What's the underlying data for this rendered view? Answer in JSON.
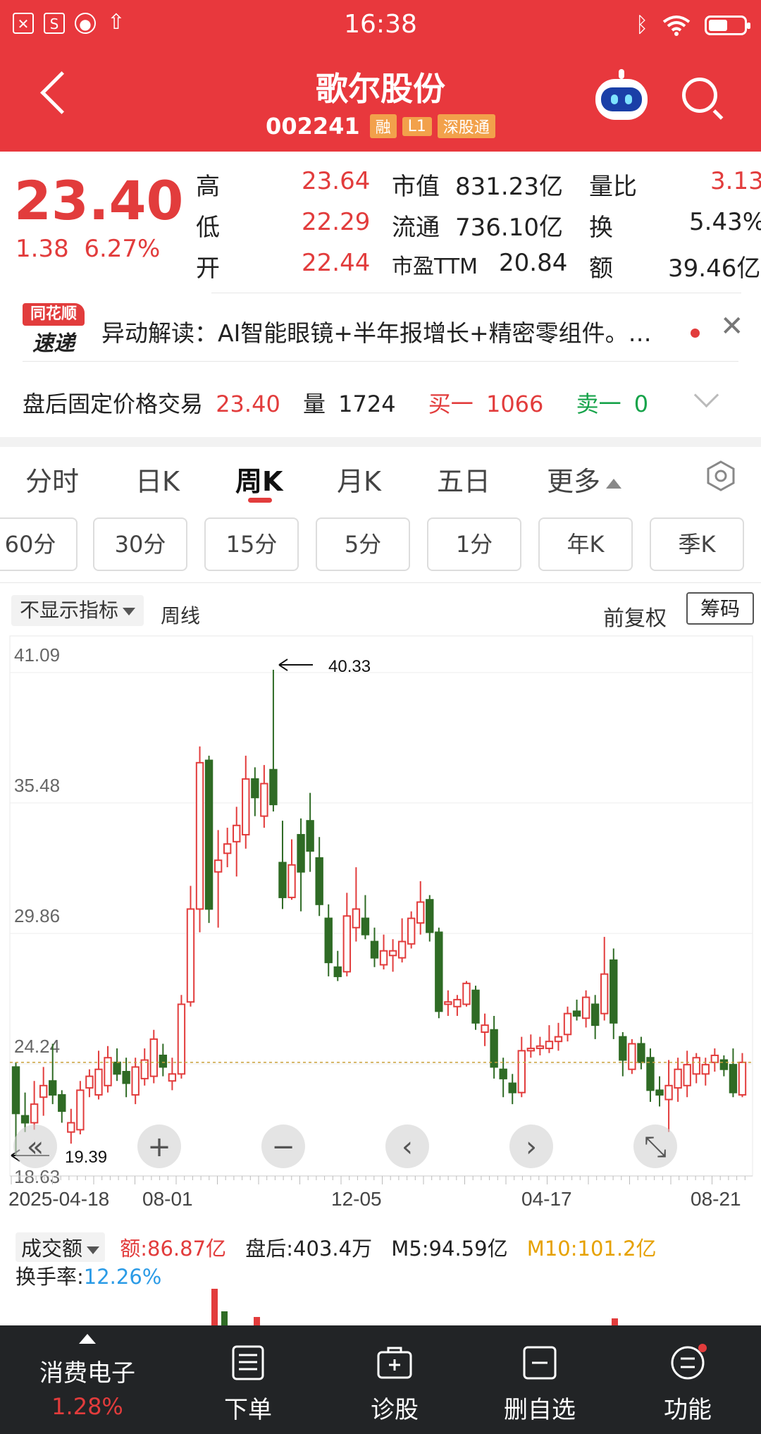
{
  "status": {
    "time": "16:38"
  },
  "header": {
    "title": "歌尔股份",
    "code": "002241",
    "tags": [
      "融",
      "L1",
      "深股通"
    ]
  },
  "quote": {
    "price": "23.40",
    "change": "1.38",
    "change_pct": "6.27%",
    "high_label": "高",
    "high": "23.64",
    "low_label": "低",
    "low": "22.29",
    "open_label": "开",
    "open": "22.44",
    "mcap_label": "市值",
    "mcap": "831.23亿",
    "float_label": "流通",
    "float": "736.10亿",
    "pe_label": "市盈TTM",
    "pe": "20.84",
    "vr_label": "量比",
    "vr": "3.13",
    "turnover_label": "换",
    "turnover": "5.43%",
    "amount_label": "额",
    "amount": "39.46亿"
  },
  "news": {
    "logo_top": "同花顺",
    "logo_bottom": "速递",
    "text": "异动解读：AI智能眼镜+半年报增长+精密零组件。…"
  },
  "after_hours": {
    "label": "盘后固定价格交易",
    "price": "23.40",
    "vol_label": "量",
    "vol": "1724",
    "buy1_label": "买一",
    "buy1": "1066",
    "sell1_label": "卖一",
    "sell1": "0"
  },
  "tabs": [
    "分时",
    "日K",
    "周K",
    "月K",
    "五日",
    "更多"
  ],
  "active_tab": "周K",
  "periods": [
    "60分",
    "30分",
    "15分",
    "5分",
    "1分",
    "年K",
    "季K"
  ],
  "chart_controls": {
    "indicator": "不显示指标",
    "period_label": "周线",
    "adjust": "前复权",
    "chips": "筹码"
  },
  "chart_data": {
    "type": "candlestick",
    "y_ticks": [
      "41.09",
      "35.48",
      "29.86",
      "24.24",
      "18.63"
    ],
    "ylim": [
      18.63,
      41.09
    ],
    "x_ticks": [
      "2025-04-18",
      "08-01",
      "12-05",
      "04-17",
      "08-21"
    ],
    "max_label": "40.33",
    "min_label": "19.39",
    "last_close": 23.4,
    "candles": [
      {
        "o": 23.2,
        "h": 23.4,
        "l": 19.4,
        "c": 21.2
      },
      {
        "o": 21.1,
        "h": 22.1,
        "l": 20.4,
        "c": 20.8
      },
      {
        "o": 20.8,
        "h": 22.6,
        "l": 20.5,
        "c": 21.6
      },
      {
        "o": 21.9,
        "h": 23.2,
        "l": 21.1,
        "c": 22.4
      },
      {
        "o": 22.6,
        "h": 24.2,
        "l": 21.6,
        "c": 22.0
      },
      {
        "o": 22.0,
        "h": 22.2,
        "l": 20.8,
        "c": 21.3
      },
      {
        "o": 20.4,
        "h": 21.4,
        "l": 19.9,
        "c": 20.8
      },
      {
        "o": 20.5,
        "h": 22.6,
        "l": 20.3,
        "c": 22.2
      },
      {
        "o": 22.3,
        "h": 23.1,
        "l": 21.9,
        "c": 22.8
      },
      {
        "o": 22.0,
        "h": 23.9,
        "l": 21.8,
        "c": 23.1
      },
      {
        "o": 22.4,
        "h": 24.1,
        "l": 22.1,
        "c": 23.6
      },
      {
        "o": 23.4,
        "h": 24.0,
        "l": 22.6,
        "c": 22.9
      },
      {
        "o": 23.0,
        "h": 23.6,
        "l": 21.9,
        "c": 22.5
      },
      {
        "o": 22.0,
        "h": 23.6,
        "l": 21.6,
        "c": 23.2
      },
      {
        "o": 22.7,
        "h": 24.0,
        "l": 22.4,
        "c": 23.5
      },
      {
        "o": 22.8,
        "h": 24.8,
        "l": 22.5,
        "c": 24.4
      },
      {
        "o": 23.7,
        "h": 24.2,
        "l": 22.8,
        "c": 23.2
      },
      {
        "o": 22.6,
        "h": 23.6,
        "l": 22.2,
        "c": 22.9
      },
      {
        "o": 22.9,
        "h": 26.3,
        "l": 22.7,
        "c": 25.9
      },
      {
        "o": 26.0,
        "h": 31.0,
        "l": 25.8,
        "c": 30.0
      },
      {
        "o": 30.0,
        "h": 37.0,
        "l": 29.0,
        "c": 36.3
      },
      {
        "o": 36.4,
        "h": 36.6,
        "l": 29.4,
        "c": 30.0
      },
      {
        "o": 31.6,
        "h": 33.4,
        "l": 29.2,
        "c": 32.1
      },
      {
        "o": 32.4,
        "h": 33.5,
        "l": 31.8,
        "c": 32.8
      },
      {
        "o": 32.9,
        "h": 34.4,
        "l": 31.4,
        "c": 33.6
      },
      {
        "o": 33.2,
        "h": 36.6,
        "l": 32.6,
        "c": 35.6
      },
      {
        "o": 35.6,
        "h": 36.1,
        "l": 34.0,
        "c": 34.8
      },
      {
        "o": 34.0,
        "h": 36.2,
        "l": 33.5,
        "c": 35.4
      },
      {
        "o": 36.0,
        "h": 40.3,
        "l": 34.2,
        "c": 34.5
      },
      {
        "o": 32.0,
        "h": 33.8,
        "l": 30.0,
        "c": 30.5
      },
      {
        "o": 30.5,
        "h": 33.0,
        "l": 30.4,
        "c": 31.9
      },
      {
        "o": 33.2,
        "h": 33.9,
        "l": 29.9,
        "c": 31.6
      },
      {
        "o": 33.8,
        "h": 35.0,
        "l": 31.6,
        "c": 32.5
      },
      {
        "o": 32.2,
        "h": 33.1,
        "l": 29.7,
        "c": 30.2
      },
      {
        "o": 29.6,
        "h": 30.2,
        "l": 27.1,
        "c": 27.7
      },
      {
        "o": 27.5,
        "h": 28.2,
        "l": 26.9,
        "c": 27.1
      },
      {
        "o": 27.3,
        "h": 30.7,
        "l": 27.1,
        "c": 29.7
      },
      {
        "o": 29.2,
        "h": 31.8,
        "l": 28.6,
        "c": 30.0
      },
      {
        "o": 29.6,
        "h": 30.6,
        "l": 28.7,
        "c": 28.9
      },
      {
        "o": 28.6,
        "h": 29.2,
        "l": 27.5,
        "c": 27.9
      },
      {
        "o": 27.6,
        "h": 28.9,
        "l": 27.4,
        "c": 28.2
      },
      {
        "o": 28.0,
        "h": 28.7,
        "l": 27.3,
        "c": 28.2
      },
      {
        "o": 27.9,
        "h": 29.6,
        "l": 27.7,
        "c": 28.6
      },
      {
        "o": 28.5,
        "h": 29.9,
        "l": 28.3,
        "c": 29.6
      },
      {
        "o": 29.4,
        "h": 31.2,
        "l": 28.9,
        "c": 30.3
      },
      {
        "o": 30.4,
        "h": 30.6,
        "l": 28.6,
        "c": 29.0
      },
      {
        "o": 29.0,
        "h": 29.2,
        "l": 25.3,
        "c": 25.6
      },
      {
        "o": 25.9,
        "h": 26.5,
        "l": 25.4,
        "c": 26.0
      },
      {
        "o": 25.8,
        "h": 26.3,
        "l": 25.4,
        "c": 26.1
      },
      {
        "o": 25.9,
        "h": 26.9,
        "l": 25.8,
        "c": 26.8
      },
      {
        "o": 26.5,
        "h": 26.7,
        "l": 24.8,
        "c": 25.1
      },
      {
        "o": 24.7,
        "h": 25.5,
        "l": 24.1,
        "c": 25.0
      },
      {
        "o": 24.8,
        "h": 25.4,
        "l": 22.7,
        "c": 23.2
      },
      {
        "o": 23.1,
        "h": 23.6,
        "l": 21.9,
        "c": 22.7
      },
      {
        "o": 22.5,
        "h": 22.9,
        "l": 21.6,
        "c": 22.1
      },
      {
        "o": 22.1,
        "h": 24.5,
        "l": 21.9,
        "c": 23.9
      },
      {
        "o": 23.9,
        "h": 24.6,
        "l": 23.6,
        "c": 24.0
      },
      {
        "o": 24.0,
        "h": 24.5,
        "l": 23.7,
        "c": 24.1
      },
      {
        "o": 24.0,
        "h": 25.0,
        "l": 23.8,
        "c": 24.3
      },
      {
        "o": 24.3,
        "h": 25.1,
        "l": 23.9,
        "c": 24.5
      },
      {
        "o": 24.6,
        "h": 25.8,
        "l": 24.3,
        "c": 25.5
      },
      {
        "o": 25.6,
        "h": 26.1,
        "l": 25.2,
        "c": 25.4
      },
      {
        "o": 25.3,
        "h": 26.5,
        "l": 24.9,
        "c": 26.2
      },
      {
        "o": 25.9,
        "h": 26.3,
        "l": 24.4,
        "c": 25.0
      },
      {
        "o": 25.5,
        "h": 28.8,
        "l": 25.2,
        "c": 27.2
      },
      {
        "o": 27.8,
        "h": 28.3,
        "l": 24.4,
        "c": 25.1
      },
      {
        "o": 24.5,
        "h": 24.7,
        "l": 22.8,
        "c": 23.5
      },
      {
        "o": 23.1,
        "h": 24.4,
        "l": 22.9,
        "c": 24.2
      },
      {
        "o": 24.2,
        "h": 24.5,
        "l": 23.1,
        "c": 23.4
      },
      {
        "o": 23.6,
        "h": 24.0,
        "l": 21.7,
        "c": 22.2
      },
      {
        "o": 22.2,
        "h": 22.8,
        "l": 21.5,
        "c": 22.0
      },
      {
        "o": 21.8,
        "h": 23.5,
        "l": 20.4,
        "c": 22.4
      },
      {
        "o": 22.3,
        "h": 23.6,
        "l": 21.7,
        "c": 23.1
      },
      {
        "o": 22.4,
        "h": 23.9,
        "l": 21.9,
        "c": 23.3
      },
      {
        "o": 22.9,
        "h": 23.8,
        "l": 22.5,
        "c": 23.6
      },
      {
        "o": 22.9,
        "h": 23.6,
        "l": 22.4,
        "c": 23.3
      },
      {
        "o": 23.4,
        "h": 24.0,
        "l": 23.0,
        "c": 23.7
      },
      {
        "o": 23.5,
        "h": 23.7,
        "l": 22.8,
        "c": 23.1
      },
      {
        "o": 23.3,
        "h": 24.0,
        "l": 21.9,
        "c": 22.1
      },
      {
        "o": 22.0,
        "h": 23.8,
        "l": 21.9,
        "c": 23.4
      }
    ]
  },
  "volume": {
    "selector": "成交额",
    "amount_label": "额:",
    "amount": "86.87亿",
    "after_label": "盘后:",
    "after": "403.4万",
    "m5_label": "M5:",
    "m5": "94.59亿",
    "m10_label": "M10:",
    "m10": "101.2亿",
    "turnover_label": "换手率:",
    "turnover": "12.26%"
  },
  "bottom_nav": {
    "sector": "消费电子",
    "sector_change": "1.28%",
    "items": [
      "下单",
      "诊股",
      "删自选",
      "功能"
    ]
  },
  "colors": {
    "brand": "#e8383d",
    "up": "#e23c3c",
    "down": "#2f6b25",
    "nav_bg": "#222426"
  }
}
